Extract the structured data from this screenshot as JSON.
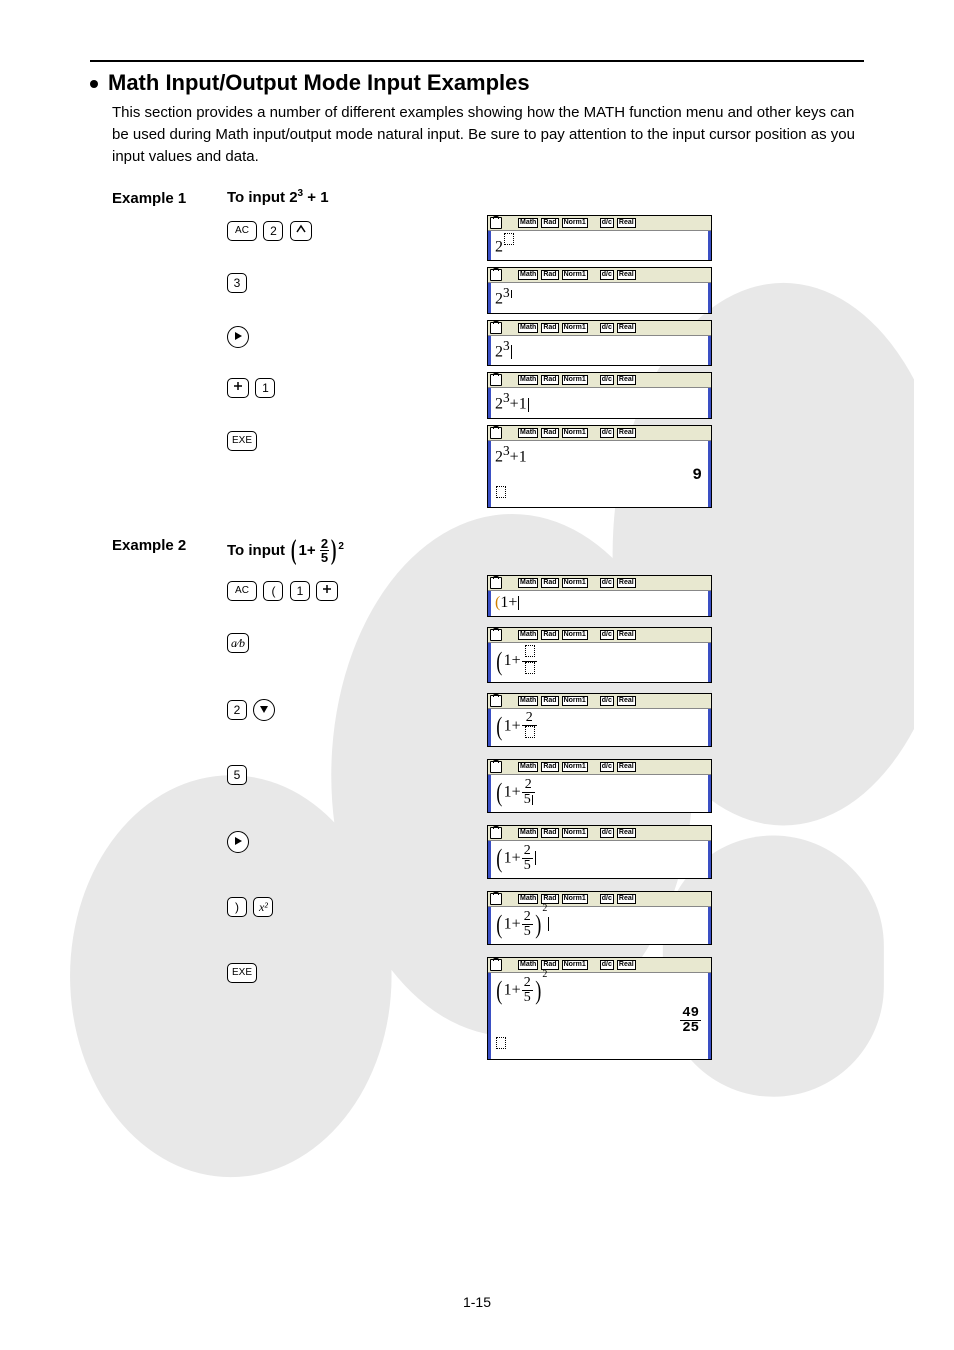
{
  "section": {
    "title": "Math Input/Output Mode Input Examples",
    "desc": "This section provides a number of different examples showing how the MATH function menu and other keys can be used during Math input/output mode natural input. Be sure to pay attention to the input cursor position as you input values and data."
  },
  "status_tags": [
    "Math",
    "Rad",
    "Norm1",
    "d/c",
    "Real"
  ],
  "example1": {
    "label": "Example 1",
    "goal_prefix": "To input 2",
    "goal_exp": "3",
    "goal_suffix": " + 1",
    "steps": [
      {
        "keys": [
          "AC",
          "2",
          "caret"
        ],
        "display": "2",
        "sup_box": true
      },
      {
        "keys": [
          "3"
        ],
        "display": "2",
        "sup": "3",
        "sup_cursor": true
      },
      {
        "keys": [
          "right"
        ],
        "display": "2",
        "sup": "3",
        "after_cursor": true
      },
      {
        "keys": [
          "plus",
          "1"
        ],
        "display_full": "2^3+1|",
        "after_cursor": true
      },
      {
        "keys": [
          "EXE"
        ],
        "display_full": "2^3+1",
        "result": "9",
        "prompt_box": true
      }
    ]
  },
  "example2": {
    "label": "Example 2",
    "goal_text": "To input ",
    "goal_inner_prefix": "1+ ",
    "goal_num": "2",
    "goal_den": "5",
    "goal_outer_exp": "2",
    "steps": [
      {
        "keys": [
          "AC",
          "(",
          "1",
          "plus"
        ],
        "display_text": "(1+",
        "after_cursor": true
      },
      {
        "keys": [
          "frac"
        ],
        "paren": true,
        "inner": "1+",
        "frac_num_box": true,
        "frac_den_box": true
      },
      {
        "keys": [
          "2",
          "down"
        ],
        "paren": true,
        "inner": "1+",
        "frac_num": "2",
        "frac_den_box": true
      },
      {
        "keys": [
          "5"
        ],
        "paren": true,
        "inner": "1+",
        "frac_num": "2",
        "frac_den": "5",
        "den_cursor": true
      },
      {
        "keys": [
          "right"
        ],
        "paren": true,
        "inner": "1+",
        "frac_num": "2",
        "frac_den": "5",
        "after_cursor": true
      },
      {
        "keys": [
          ")",
          "x2"
        ],
        "paren_both": true,
        "inner": "1+",
        "frac_num": "2",
        "frac_den": "5",
        "outer_exp": "2",
        "exp_cursor": true
      },
      {
        "keys": [
          "EXE"
        ],
        "paren_both": true,
        "inner": "1+",
        "frac_num": "2",
        "frac_den": "5",
        "outer_exp": "2",
        "result_frac": {
          "num": "49",
          "den": "25"
        },
        "prompt_box": true
      }
    ]
  },
  "page_number": "1-15"
}
